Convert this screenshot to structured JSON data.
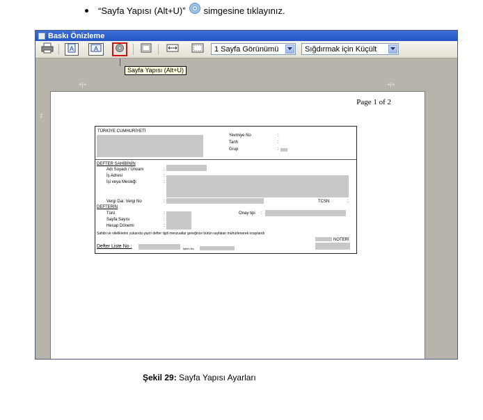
{
  "instruction": {
    "prefix": "“Sayfa Yapısı (Alt+U)”",
    "icon": "page-setup-gear-icon",
    "suffix": "simgesine  tıklayınız."
  },
  "window": {
    "title": "Baskı Önizleme",
    "toolbar": {
      "buttons": [
        "print-icon",
        "portrait-icon",
        "landscape-icon",
        "page-setup-icon",
        "one-page-icon",
        "page-width-icon",
        "two-pages-icon"
      ],
      "view_select": "1 Sayfa Görünümü",
      "zoom_select": "Sığdırmak için Küçült"
    },
    "tooltip": "Sayfa Yapısı (Alt+U)",
    "page": {
      "page_number": "Page 1 of 2",
      "form": {
        "header": "TÜRKİYE CUMHURİYETİ",
        "right_labels": [
          "Yevmiye No",
          "Tarih",
          "Grup"
        ],
        "section1": "DEFTER SAHİBİNİN",
        "section1_labels": [
          "Adı Soyadı / Ünvanı",
          "İş Adresi",
          "İşi veya Mesleği"
        ],
        "tax_label": "Vergi Dai. Vergi No",
        "tcsn_label": "TCSN",
        "section2": "DEFTERİN",
        "section2_labels": [
          "Türü",
          "Sayfa Sayısı",
          "Hesap Dönemi"
        ],
        "onay_label": "Onay tipi",
        "statement": "Sahibi ve niteliklerini yukarıda yazılı defter ilgili mevzuatlar gereğince bütün sayfaları mühürlenerek onaylandı",
        "noter_label": "NOTERİ",
        "list_label": "Defter Liste No :",
        "small_label": "İşlem No"
      }
    }
  },
  "caption": {
    "bold": "Şekil 29:",
    "text": " Sayfa Yapısı Ayarları"
  }
}
